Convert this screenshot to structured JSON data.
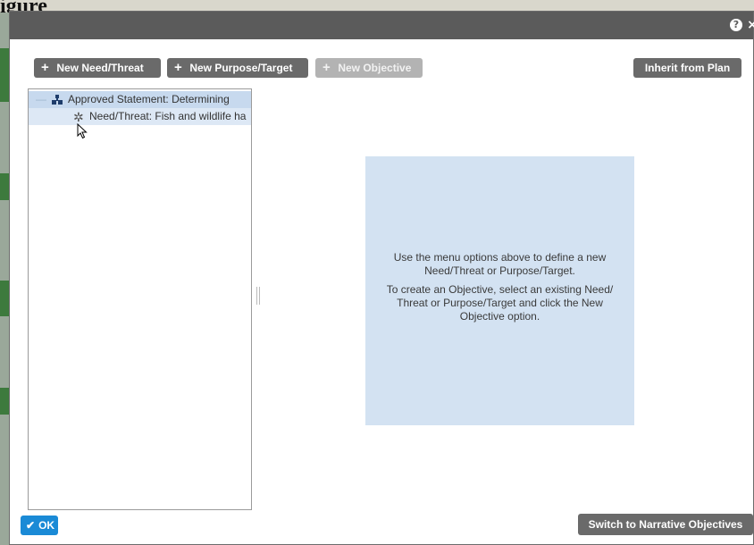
{
  "backdrop": {
    "caption": "igure"
  },
  "titlebar": {
    "help_glyph": "?",
    "close_glyph": "×"
  },
  "toolbar": {
    "new_need_label": "New Need/Threat",
    "new_purpose_label": "New Purpose/Target",
    "new_objective_label": "New Objective",
    "inherit_label": "Inherit from Plan"
  },
  "tree": {
    "items": [
      {
        "label": "Approved Statement: Determining",
        "icon": "org-chart-icon",
        "expanded": true
      },
      {
        "label": "Need/Threat: Fish and wildlife ha",
        "icon": "spinner-icon"
      }
    ]
  },
  "info": {
    "line1": "Use the menu options above to define a new Need/Threat or Purpose/Target.",
    "line2": "To create an Objective, select an existing Need/ Threat or Purpose/Target and click the New Objective option."
  },
  "footer": {
    "ok_label": "OK",
    "switch_label": "Switch to Narrative Objectives"
  },
  "colors": {
    "titlebar": "#5b5b5b",
    "button": "#6a6a6a",
    "button_disabled": "#b3b3b3",
    "ok_button": "#1a8ad6",
    "tree_selected": "#c7d9ee",
    "info_box": "#d3e2f2"
  }
}
